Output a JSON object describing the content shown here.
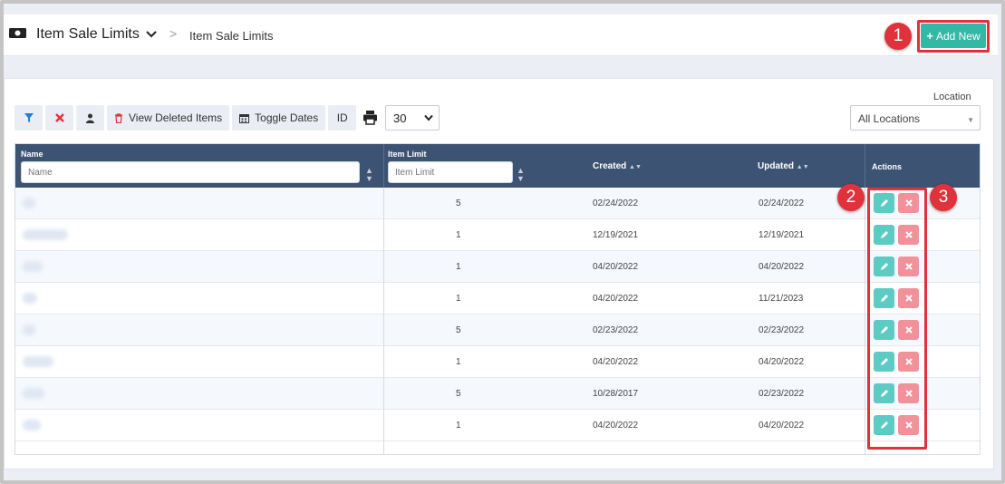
{
  "header": {
    "title": "Item Sale Limits",
    "breadcrumb_sep": ">",
    "breadcrumb": "Item Sale Limits",
    "add_new_label": "Add New",
    "add_new_plus": "+"
  },
  "callouts": [
    "1",
    "2",
    "3"
  ],
  "toolbar": {
    "view_deleted_label": "View Deleted Items",
    "toggle_dates_label": "Toggle Dates",
    "id_label": "ID",
    "page_size": "30"
  },
  "location": {
    "label": "Location",
    "value": "All Locations"
  },
  "table": {
    "columns": {
      "name": "Name",
      "name_placeholder": "Name",
      "item_limit": "Item Limit",
      "item_limit_placeholder": "Item Limit",
      "created": "Created",
      "updated": "Updated",
      "actions": "Actions"
    },
    "rows": [
      {
        "item_limit": "5",
        "created": "02/24/2022",
        "updated": "02/24/2022"
      },
      {
        "item_limit": "1",
        "created": "12/19/2021",
        "updated": "12/19/2021"
      },
      {
        "item_limit": "1",
        "created": "04/20/2022",
        "updated": "04/20/2022"
      },
      {
        "item_limit": "1",
        "created": "04/20/2022",
        "updated": "11/21/2023"
      },
      {
        "item_limit": "5",
        "created": "02/23/2022",
        "updated": "02/23/2022"
      },
      {
        "item_limit": "1",
        "created": "04/20/2022",
        "updated": "04/20/2022"
      },
      {
        "item_limit": "5",
        "created": "10/28/2017",
        "updated": "02/23/2022"
      },
      {
        "item_limit": "1",
        "created": "04/20/2022",
        "updated": "04/20/2022"
      }
    ]
  },
  "colors": {
    "accent": "#34b8a6",
    "header_bg": "#3d5373",
    "callout": "#e0323b",
    "edit": "#5dcbc4",
    "delete": "#f2919a"
  },
  "icons": [
    "app-icon",
    "chevron-down-icon",
    "filter-icon",
    "clear-filter-icon",
    "user-icon",
    "trash-icon",
    "calendar-icon",
    "print-icon",
    "sort-icon",
    "edit-icon",
    "delete-icon"
  ]
}
